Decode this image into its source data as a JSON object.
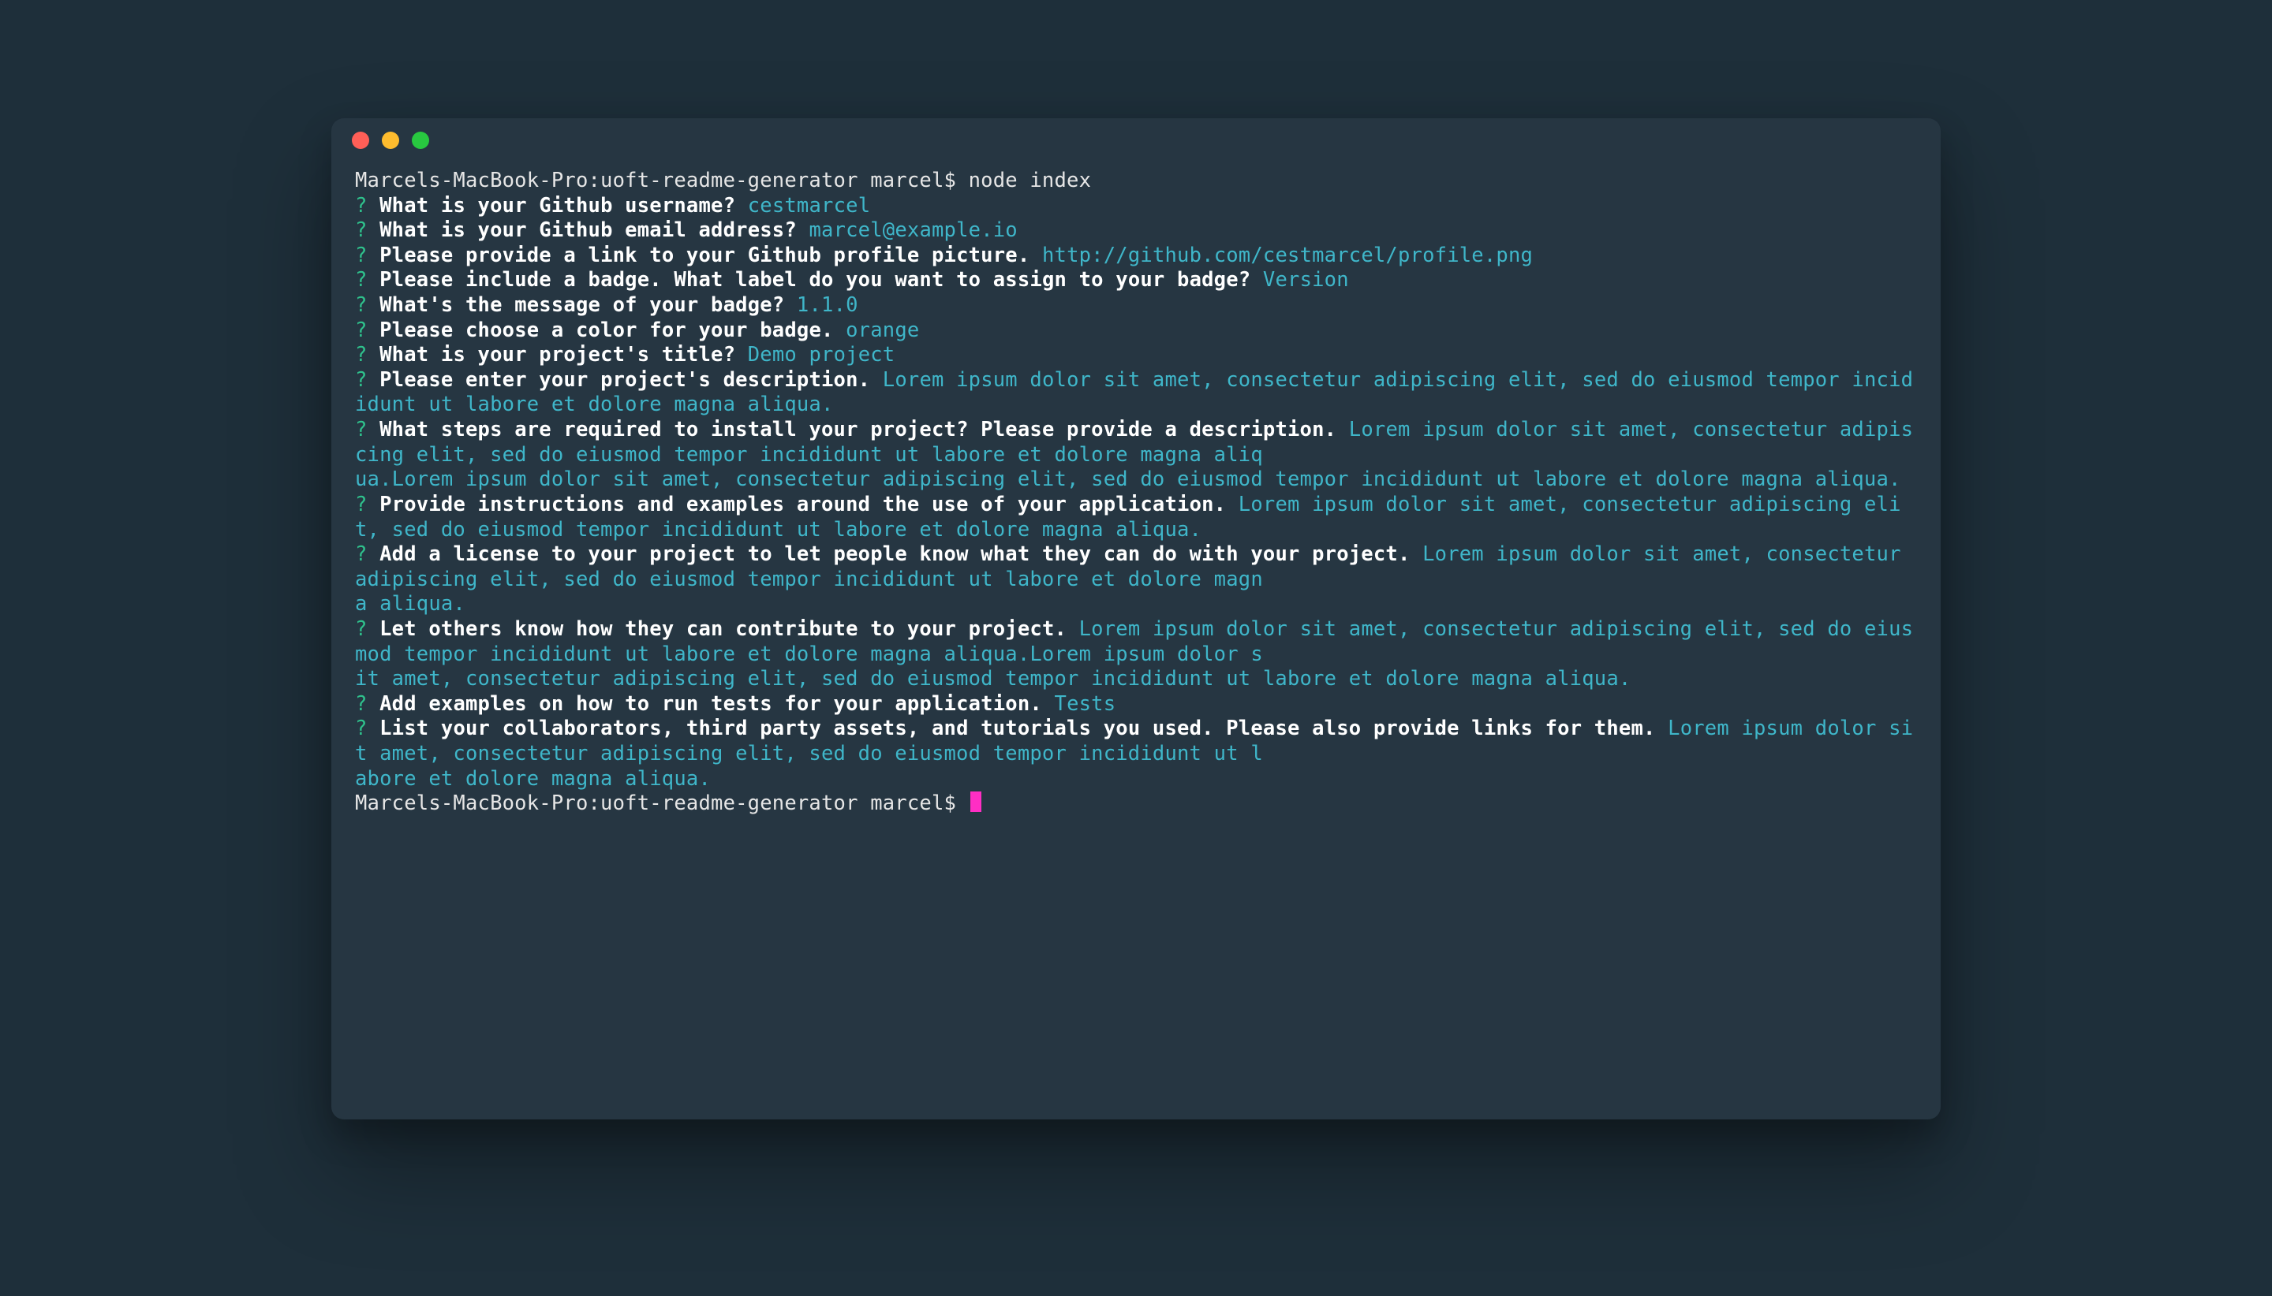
{
  "promptStart": "Marcels-MacBook-Pro:uoft-readme-generator marcel$ node index",
  "promptEnd": "Marcels-MacBook-Pro:uoft-readme-generator marcel$ ",
  "qmark": "?",
  "lines": [
    {
      "q": "What is your Github username?",
      "a": "cestmarcel"
    },
    {
      "q": "What is your Github email address?",
      "a": "marcel@example.io"
    },
    {
      "q": "Please provide a link to your Github profile picture.",
      "a": "http://github.com/cestmarcel/profile.png"
    },
    {
      "q": "Please include a badge. What label do you want to assign to your badge?",
      "a": "Version"
    },
    {
      "q": "What's the message of your badge?",
      "a": "1.1.0"
    },
    {
      "q": "Please choose a color for your badge.",
      "a": "orange"
    },
    {
      "q": "What is your project's title?",
      "a": "Demo project"
    },
    {
      "q": "Please enter your project's description.",
      "a": "Lorem ipsum dolor sit amet, consectetur adipiscing elit, sed do eiusmod tempor incididunt ut labore et dolore magna aliqua."
    },
    {
      "q": "What steps are required to install your project? Please provide a description.",
      "a": "Lorem ipsum dolor sit amet, consectetur adipiscing elit, sed do eiusmod tempor incididunt ut labore et dolore magna aliq\nua.Lorem ipsum dolor sit amet, consectetur adipiscing elit, sed do eiusmod tempor incididunt ut labore et dolore magna aliqua."
    },
    {
      "q": "Provide instructions and examples around the use of your application.",
      "a": "Lorem ipsum dolor sit amet, consectetur adipiscing elit, sed do eiusmod tempor incididunt ut labore et dolore magna aliqua."
    },
    {
      "q": "Add a license to your project to let people know what they can do with your project.",
      "a": "Lorem ipsum dolor sit amet, consectetur adipiscing elit, sed do eiusmod tempor incididunt ut labore et dolore magn\na aliqua."
    },
    {
      "q": "Let others know how they can contribute to your project.",
      "a": "Lorem ipsum dolor sit amet, consectetur adipiscing elit, sed do eiusmod tempor incididunt ut labore et dolore magna aliqua.Lorem ipsum dolor s\nit amet, consectetur adipiscing elit, sed do eiusmod tempor incididunt ut labore et dolore magna aliqua."
    },
    {
      "q": "Add examples on how to run tests for your application.",
      "a": "Tests"
    },
    {
      "q": "List your collaborators, third party assets, and tutorials you used. Please also provide links for them.",
      "a": "Lorem ipsum dolor sit amet, consectetur adipiscing elit, sed do eiusmod tempor incididunt ut l\nabore et dolore magna aliqua."
    }
  ]
}
